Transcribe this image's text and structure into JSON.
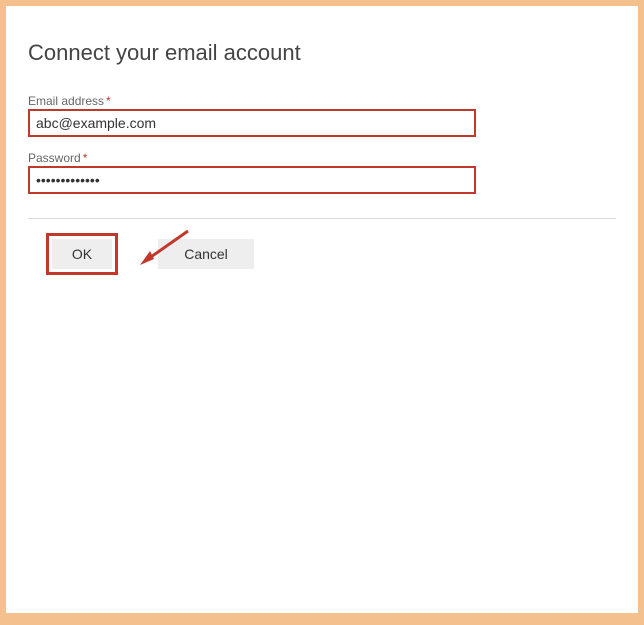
{
  "title": "Connect your email account",
  "fields": {
    "email": {
      "label": "Email address",
      "required_mark": "*",
      "value": "abc@example.com"
    },
    "password": {
      "label": "Password",
      "required_mark": "*",
      "value": "•••••••••••••"
    }
  },
  "buttons": {
    "ok": "OK",
    "cancel": "Cancel"
  },
  "annotation": {
    "highlight_color": "#c0392b"
  }
}
